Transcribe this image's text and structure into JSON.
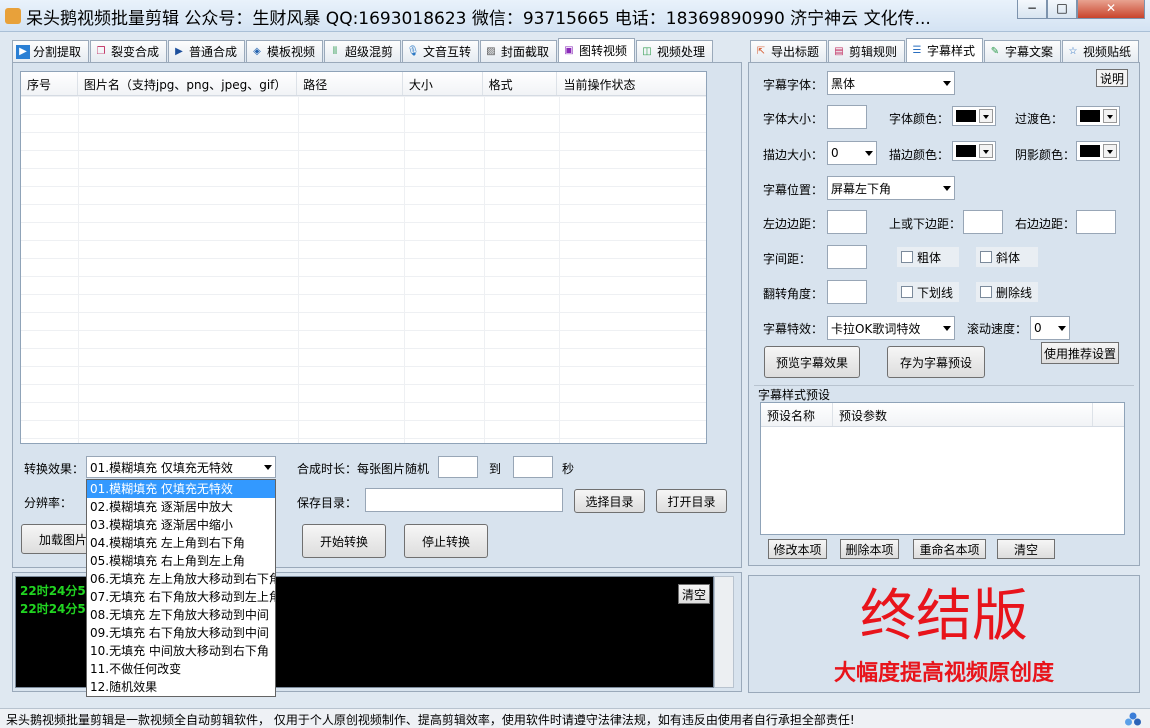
{
  "window": {
    "title": "呆头鹅视频批量剪辑 公众号：生财风暴 QQ:1693018623 微信：93715665 电话：18369890990 济宁神云 文化传...",
    "min_label": "−",
    "max_label": "□",
    "close_label": "✕"
  },
  "left_tabs": [
    {
      "label": "分割提取",
      "icon": "video-play-icon"
    },
    {
      "label": "裂变合成",
      "icon": "squares-icon"
    },
    {
      "label": "普通合成",
      "icon": "play-icon"
    },
    {
      "label": "模板视频",
      "icon": "template-icon"
    },
    {
      "label": "超级混剪",
      "icon": "waveform-icon"
    },
    {
      "label": "文音互转",
      "icon": "microphone-icon"
    },
    {
      "label": "封面截取",
      "icon": "image-icon"
    },
    {
      "label": "图转视频",
      "icon": "slideshow-icon"
    },
    {
      "label": "视频处理",
      "icon": "film-icon"
    }
  ],
  "right_tabs": [
    {
      "label": "导出标题",
      "icon": "export-icon"
    },
    {
      "label": "剪辑规则",
      "icon": "rules-icon"
    },
    {
      "label": "字幕样式",
      "icon": "subtitle-icon"
    },
    {
      "label": "字幕文案",
      "icon": "edit-icon"
    },
    {
      "label": "视频贴纸",
      "icon": "star-icon"
    }
  ],
  "table": {
    "columns": [
      "序号",
      "图片名（支持jpg、png、jpeg、gif）",
      "路径",
      "大小",
      "格式",
      "当前操作状态"
    ]
  },
  "convert": {
    "effect_label": "转换效果：",
    "effect_value": "01.模糊填充 仅填充无特效",
    "resolution_label": "分辨率：",
    "duration_label": "合成时长：每张图片随机",
    "to_label": "到",
    "sec_label": "秒",
    "save_dir_label": "保存目录：",
    "choose_dir": "选择目录",
    "open_dir": "打开目录",
    "load_button": "加载图片",
    "start_button": "开始转换",
    "stop_button": "停止转换"
  },
  "dropdown_options": [
    "01.模糊填充 仅填充无特效",
    "02.模糊填充 逐渐居中放大",
    "03.模糊填充 逐渐居中缩小",
    "04.模糊填充 左上角到右下角",
    "05.模糊填充 右上角到左上角",
    "06.无填充 左上角放大移动到右下角",
    "07.无填充 右下角放大移动到左上角",
    "08.无填充 左下角放大移动到中间",
    "09.无填充 右下角放大移动到中间",
    "10.无填充 中间放大移动到右下角",
    "11.不做任何改变",
    "12.随机效果"
  ],
  "log": {
    "lines": [
      "22时24分51",
      "22时24分54"
    ],
    "clear_button": "清空"
  },
  "subtitle": {
    "help_button": "说明",
    "font_label": "字幕字体：",
    "font_value": "黑体",
    "size_label": "字体大小：",
    "color_label": "字体颜色：",
    "transition_label": "过渡色：",
    "stroke_size_label": "描边大小：",
    "stroke_size_value": "0",
    "stroke_color_label": "描边颜色：",
    "shadow_color_label": "阴影颜色：",
    "position_label": "字幕位置：",
    "position_value": "屏幕左下角",
    "left_margin_label": "左边边距：",
    "vert_margin_label": "上或下边距：",
    "right_margin_label": "右边边距：",
    "spacing_label": "字间距：",
    "bold_label": "粗体",
    "italic_label": "斜体",
    "rotate_label": "翻转角度：",
    "underline_label": "下划线",
    "strike_label": "删除线",
    "effect_label": "字幕特效：",
    "effect_value": "卡拉OK歌词特效",
    "scroll_label": "滚动速度：",
    "scroll_value": "0",
    "preview_button": "预览字幕效果",
    "save_preset_button": "存为字幕预设",
    "recommend_button": "使用推荐设置",
    "swatch_color": "#000000"
  },
  "preset": {
    "group_label": "字幕样式预设",
    "columns": [
      "预设名称",
      "预设参数"
    ],
    "modify_button": "修改本项",
    "delete_button": "删除本项",
    "rename_button": "重命名本项",
    "clear_button": "清空"
  },
  "promo": {
    "headline": "终结版",
    "subline": "大幅度提高视频原创度",
    "color": "#e8141b"
  },
  "status": {
    "text": "呆头鹅视频批量剪辑是一款视频全自动剪辑软件， 仅用于个人原创视频制作、提高剪辑效率，使用软件时请遵守法律法规，如有违反由使用者自行承担全部责任!"
  }
}
